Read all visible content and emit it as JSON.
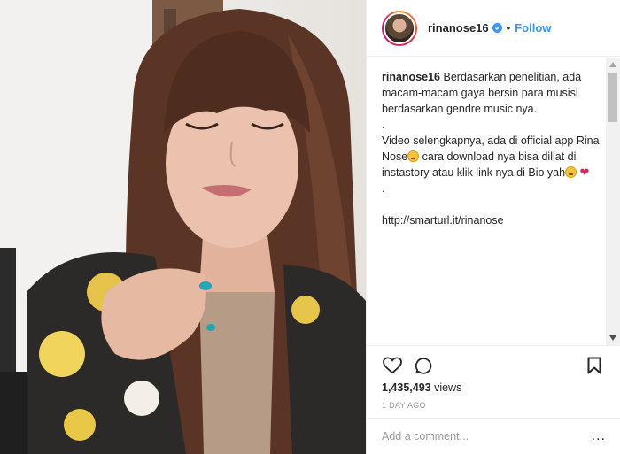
{
  "header": {
    "username": "rinanose16",
    "separator": "•",
    "follow_label": "Follow",
    "verified_icon": "verified-badge-icon"
  },
  "caption": {
    "username": "rinanose16",
    "line1": "Berdasarkan penelitian, ada macam-macam gaya bersin para musisi berdasarkan gendre music nya.",
    "dot1": ".",
    "line2a": "Video selengkapnya, ada di official app Rina Nose",
    "line2b": " cara download nya bisa diliat di instastory atau klik link nya di Bio yah",
    "dot2": ".",
    "link": "http://smarturl.it/rinanose"
  },
  "actions": {
    "like_icon": "heart-icon",
    "comment_icon": "comment-icon",
    "save_icon": "bookmark-icon"
  },
  "stats": {
    "views_count": "1,435,493",
    "views_label": " views",
    "time_ago": "1 DAY AGO"
  },
  "comment_box": {
    "placeholder": "Add a comment...",
    "more_label": "..."
  },
  "colors": {
    "accent": "#3897f0",
    "border": "#efefef",
    "muted": "#999999",
    "heart": "#e0245e"
  }
}
